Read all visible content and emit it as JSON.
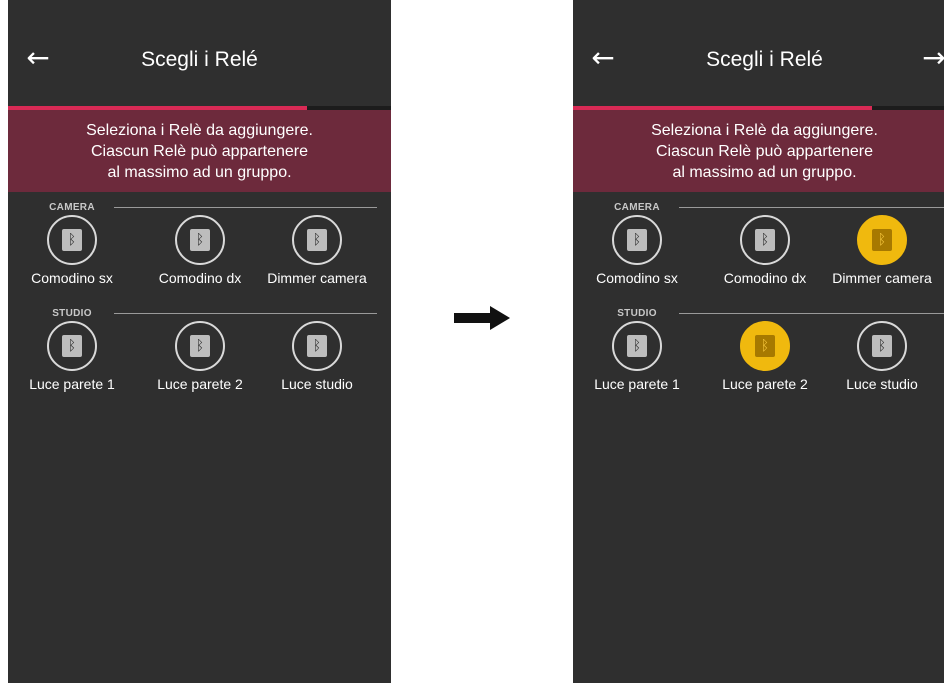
{
  "screens": [
    {
      "title": "Scegli i Relé",
      "back_icon": "arrow-left-icon",
      "next_icon": null,
      "progress": 0.78,
      "instructions": [
        "Seleziona i Relè da aggiungere.",
        "Ciascun Relè può appartenere",
        "al massimo ad un gruppo."
      ],
      "groups": [
        {
          "label": "CAMERA",
          "relays": [
            {
              "name": "Comodino sx",
              "selected": false
            },
            {
              "name": "Comodino dx",
              "selected": false
            },
            {
              "name": "Dimmer camera",
              "selected": false
            }
          ]
        },
        {
          "label": "STUDIO",
          "relays": [
            {
              "name": "Luce parete 1",
              "selected": false
            },
            {
              "name": "Luce parete 2",
              "selected": false
            },
            {
              "name": "Luce studio",
              "selected": false
            }
          ]
        }
      ]
    },
    {
      "title": "Scegli i Relé",
      "back_icon": "arrow-left-icon",
      "next_icon": "arrow-right-icon",
      "progress": 0.78,
      "instructions": [
        "Seleziona i Relè da aggiungere.",
        "Ciascun Relè può appartenere",
        "al massimo ad un gruppo."
      ],
      "groups": [
        {
          "label": "CAMERA",
          "relays": [
            {
              "name": "Comodino sx",
              "selected": false
            },
            {
              "name": "Comodino dx",
              "selected": false
            },
            {
              "name": "Dimmer camera",
              "selected": true
            }
          ]
        },
        {
          "label": "STUDIO",
          "relays": [
            {
              "name": "Luce parete 1",
              "selected": false
            },
            {
              "name": "Luce parete 2",
              "selected": true
            },
            {
              "name": "Luce studio",
              "selected": false
            }
          ]
        }
      ]
    }
  ],
  "transition_icon": "arrow-right-icon",
  "colors": {
    "background": "#2f2f2f",
    "accent": "#d92a55",
    "banner": "#6d2a3c",
    "selected": "#f0b90e"
  }
}
